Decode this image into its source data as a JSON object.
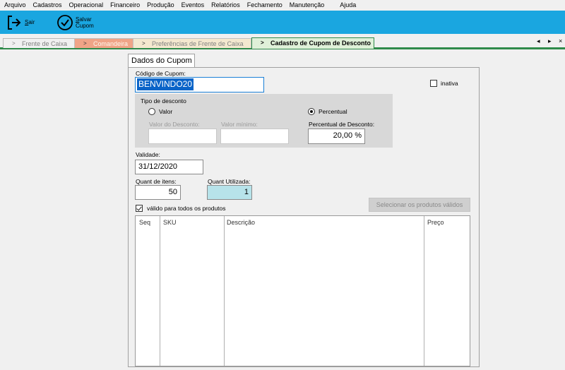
{
  "menu": [
    "Arquivo",
    "Cadastros",
    "Operacional",
    "Financeiro",
    "Produção",
    "Eventos",
    "Relatórios",
    "Fechamento",
    "Manutenção",
    "Ajuda"
  ],
  "toolbar": {
    "exit_hotkey": "S",
    "exit_rest": "air",
    "save_hotkey": "S",
    "save_rest": "alvar",
    "save_line2": "Cupom",
    "bg_color": "#1aa6e0"
  },
  "tabs": {
    "t1": "Frente de Caixa",
    "t2": "Comandeira",
    "t3": "Preferências de Frente de Caixa",
    "t4": "Cadastro de Cupom de Desconto",
    "arrow": ">",
    "ctrl_prev": "◂",
    "ctrl_next": "▸",
    "ctrl_close": "×"
  },
  "form": {
    "tab_title": "Dados do Cupom",
    "code_label": "Código de Cupom:",
    "code_value": "BENVINDO20",
    "inactive_label": "inativa",
    "discount_type_label": "Tipo de desconto",
    "opt_value": "Valor",
    "opt_percent": "Percentual",
    "discount_value_label": "Valor do Desconto:",
    "min_value_label": "Valor mínimo:",
    "percent_label": "Percentual de Desconto:",
    "percent_value": "20,00 %",
    "validity_label": "Validade:",
    "validity_value": "31/12/2020",
    "qty_items_label": "Quant de itens:",
    "qty_items_value": "50",
    "qty_used_label": "Quant Utilizada:",
    "qty_used_value": "1",
    "all_products_label": "válido para todos os produtos",
    "select_products_button": "Selecionar os produtos válidos"
  },
  "grid": {
    "columns": [
      "Seq",
      "SKU",
      "Descrição",
      "Preço"
    ]
  }
}
